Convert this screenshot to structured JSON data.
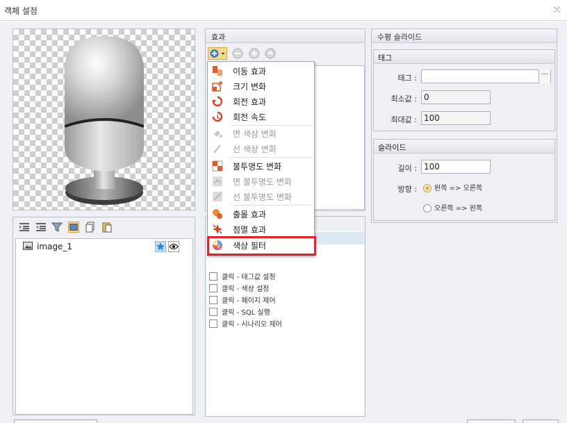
{
  "window": {
    "title": "객체 설정",
    "close_icon": "close-icon"
  },
  "layers": {
    "toolbar_icons": [
      "indent-icon",
      "outdent-icon",
      "filter-icon",
      "image-layer-icon",
      "copy-icon",
      "paste-icon"
    ],
    "items": [
      {
        "name": "image_1",
        "icons": [
          "star-icon",
          "eye-icon"
        ]
      }
    ]
  },
  "effects_panel": {
    "title": "효과",
    "toolbar_icons": [
      "add-effect-icon",
      "remove-icon",
      "move-down-icon",
      "move-up-icon"
    ]
  },
  "effect_menu": {
    "items": [
      {
        "label": "이동 효과",
        "icon": "move-effect-icon",
        "enabled": true
      },
      {
        "label": "크기 변화",
        "icon": "resize-effect-icon",
        "enabled": true
      },
      {
        "label": "회전 효과",
        "icon": "rotate-effect-icon",
        "enabled": true
      },
      {
        "label": "회전 속도",
        "icon": "rotation-speed-icon",
        "enabled": true
      },
      {
        "label": "면 색상 변화",
        "icon": "fill-color-icon",
        "enabled": false
      },
      {
        "label": "선 색상 변화",
        "icon": "line-color-icon",
        "enabled": false
      },
      {
        "label": "불투명도 변화",
        "icon": "opacity-icon",
        "enabled": true
      },
      {
        "label": "면 불투명도 변화",
        "icon": "fill-opacity-icon",
        "enabled": false
      },
      {
        "label": "선 불투명도 변화",
        "icon": "line-opacity-icon",
        "enabled": false
      },
      {
        "label": "출몰 효과",
        "icon": "appear-effect-icon",
        "enabled": true
      },
      {
        "label": "점멸 효과",
        "icon": "blink-effect-icon",
        "enabled": true
      },
      {
        "label": "색상 필터",
        "icon": "color-filter-icon",
        "enabled": true,
        "highlighted": true
      }
    ],
    "highlight_color": "#e8222a"
  },
  "events": {
    "items": [
      {
        "label": "클릭 - 태그값 설정",
        "checked": false
      },
      {
        "label": "클릭 - 색상 설정",
        "checked": false
      },
      {
        "label": "클릭 - 페이지 제어",
        "checked": false
      },
      {
        "label": "클릭 - SQL 실행",
        "checked": false
      },
      {
        "label": "클릭 - 시나리오 제어",
        "checked": false
      }
    ]
  },
  "slide_panel": {
    "title": "수평 슬라이드",
    "tag_group": {
      "title": "태그",
      "tag_label": "태그 :",
      "tag_value": "",
      "browse_label": "···",
      "min_label": "최소값 :",
      "min_value": "0",
      "max_label": "최대값 :",
      "max_value": "100"
    },
    "slider_group": {
      "title": "슬라이드",
      "length_label": "길이 :",
      "length_value": "100",
      "direction_label": "방향 :",
      "direction_options": [
        {
          "label": "왼쪽 => 오른쪽",
          "selected": true
        },
        {
          "label": "오른쪽 => 왼쪽",
          "selected": false
        }
      ]
    }
  },
  "colors": {
    "accent": "#f2b233",
    "panel_border": "#b9c1cc",
    "background": "#eef0f3"
  }
}
